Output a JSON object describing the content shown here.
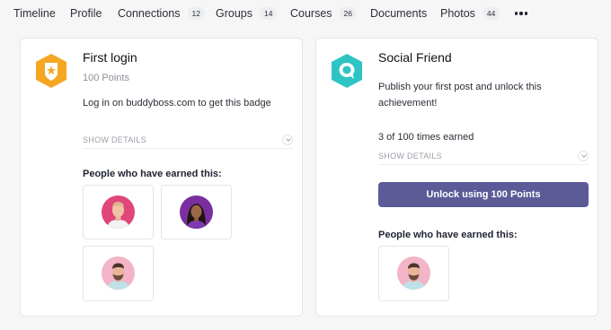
{
  "nav": {
    "timeline": "Timeline",
    "profile": "Profile",
    "connections": "Connections",
    "connections_count": "12",
    "groups": "Groups",
    "groups_count": "14",
    "courses": "Courses",
    "courses_count": "26",
    "documents": "Documents",
    "photos": "Photos",
    "photos_count": "44"
  },
  "colors": {
    "badge1": "#f5a623",
    "badge2": "#2ec4c4",
    "button": "#5c5b97"
  },
  "cards": [
    {
      "title": "First login",
      "points": "100 Points",
      "description": "Log in on buddyboss.com to get this badge",
      "details_label": "SHOW DETAILS",
      "earned_heading": "People who have earned this:",
      "icon": "badge-shield-star-icon"
    },
    {
      "title": "Social Friend",
      "description_line1": "Publish your first post and unlock this",
      "description_line2": "achievement!",
      "times_earned": "3 of 100 times earned",
      "details_label": "SHOW DETAILS",
      "unlock_label": "Unlock using 100 Points",
      "earned_heading": "People who have earned this:",
      "icon": "badge-speech-bubble-icon"
    }
  ]
}
